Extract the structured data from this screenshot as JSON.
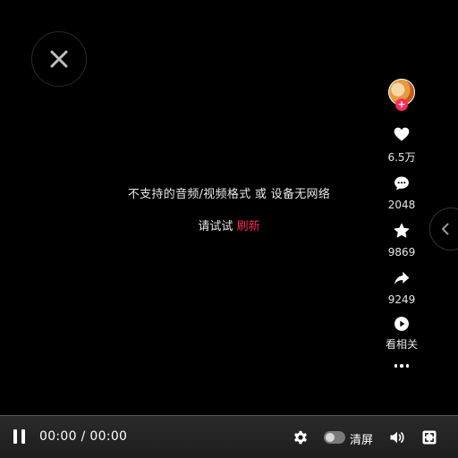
{
  "message": {
    "error": "不支持的音频/视频格式 或 设备无网络",
    "retry_prefix": "请试试",
    "retry_link": "刷新"
  },
  "sidebar": {
    "like_count": "6.5万",
    "comment_count": "2048",
    "favorite_count": "9869",
    "share_count": "9249",
    "related_label": "看相关",
    "follow_plus": "+"
  },
  "controls": {
    "current_time": "00:00",
    "separator": "/",
    "duration": "00:00",
    "clear_mode_label": "清屏",
    "clear_mode_on": false
  },
  "colors": {
    "accent": "#fe2c55",
    "background": "#000000",
    "controls_bg": "#232323"
  }
}
